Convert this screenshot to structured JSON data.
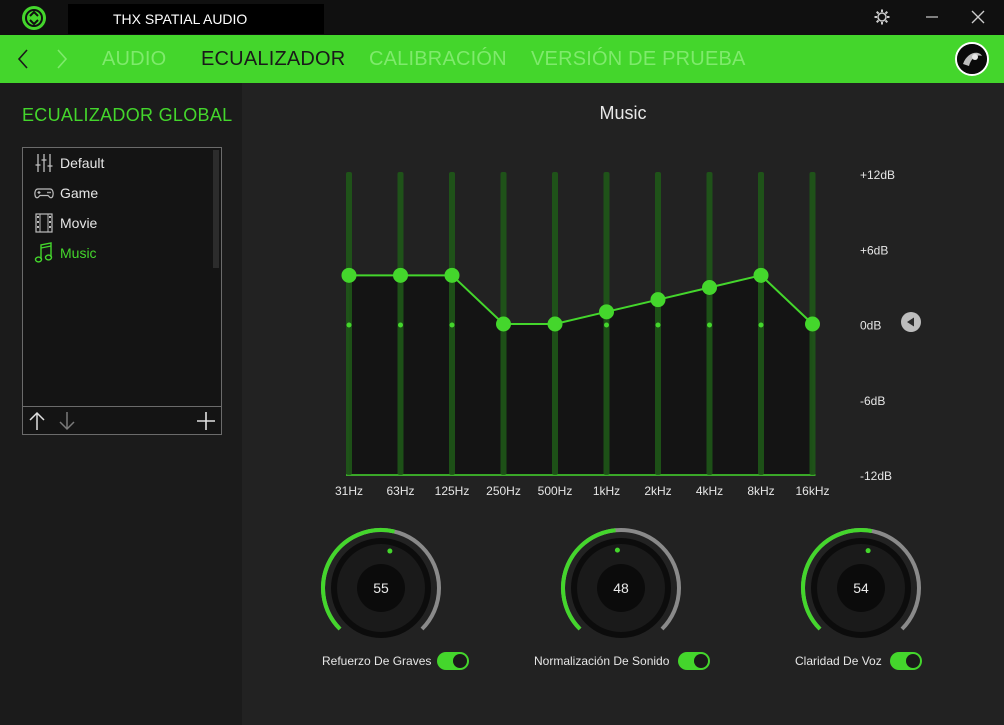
{
  "window": {
    "title": "THX SPATIAL AUDIO"
  },
  "nav": {
    "tabs": [
      {
        "label": "AUDIO",
        "active": false
      },
      {
        "label": "ECUALIZADOR",
        "active": true
      },
      {
        "label": "CALIBRACIÓN",
        "active": false
      },
      {
        "label": "VERSIÓN DE PRUEBA",
        "active": false
      }
    ]
  },
  "sidebar": {
    "title": "ECUALIZADOR GLOBAL",
    "presets": [
      {
        "label": "Default",
        "icon": "sliders-icon",
        "selected": false
      },
      {
        "label": "Game",
        "icon": "gamepad-icon",
        "selected": false
      },
      {
        "label": "Movie",
        "icon": "film-icon",
        "selected": false
      },
      {
        "label": "Music",
        "icon": "music-note-icon",
        "selected": true
      }
    ]
  },
  "equalizer": {
    "preset_name": "Music",
    "db_labels": [
      "+12dB",
      "+6dB",
      "0dB",
      "-6dB",
      "-12dB"
    ],
    "bands": [
      {
        "freq": "31Hz",
        "gain": 4
      },
      {
        "freq": "63Hz",
        "gain": 4
      },
      {
        "freq": "125Hz",
        "gain": 4
      },
      {
        "freq": "250Hz",
        "gain": 0
      },
      {
        "freq": "500Hz",
        "gain": 0
      },
      {
        "freq": "1kHz",
        "gain": 1
      },
      {
        "freq": "2kHz",
        "gain": 2
      },
      {
        "freq": "4kHz",
        "gain": 3
      },
      {
        "freq": "8kHz",
        "gain": 4
      },
      {
        "freq": "16kHz",
        "gain": 0
      }
    ],
    "range": [
      -12,
      12
    ]
  },
  "knobs": [
    {
      "label": "Refuerzo De Graves",
      "value": "55",
      "level": 0.55,
      "enabled": true
    },
    {
      "label": "Normalización De Sonido",
      "value": "48",
      "level": 0.48,
      "enabled": true
    },
    {
      "label": "Claridad De Voz",
      "value": "54",
      "level": 0.54,
      "enabled": true
    }
  ],
  "colors": {
    "accent": "#44d62c",
    "nav_bg": "#44d62c",
    "main_bg": "#222222",
    "sidebar_bg": "#1b1b1b"
  }
}
